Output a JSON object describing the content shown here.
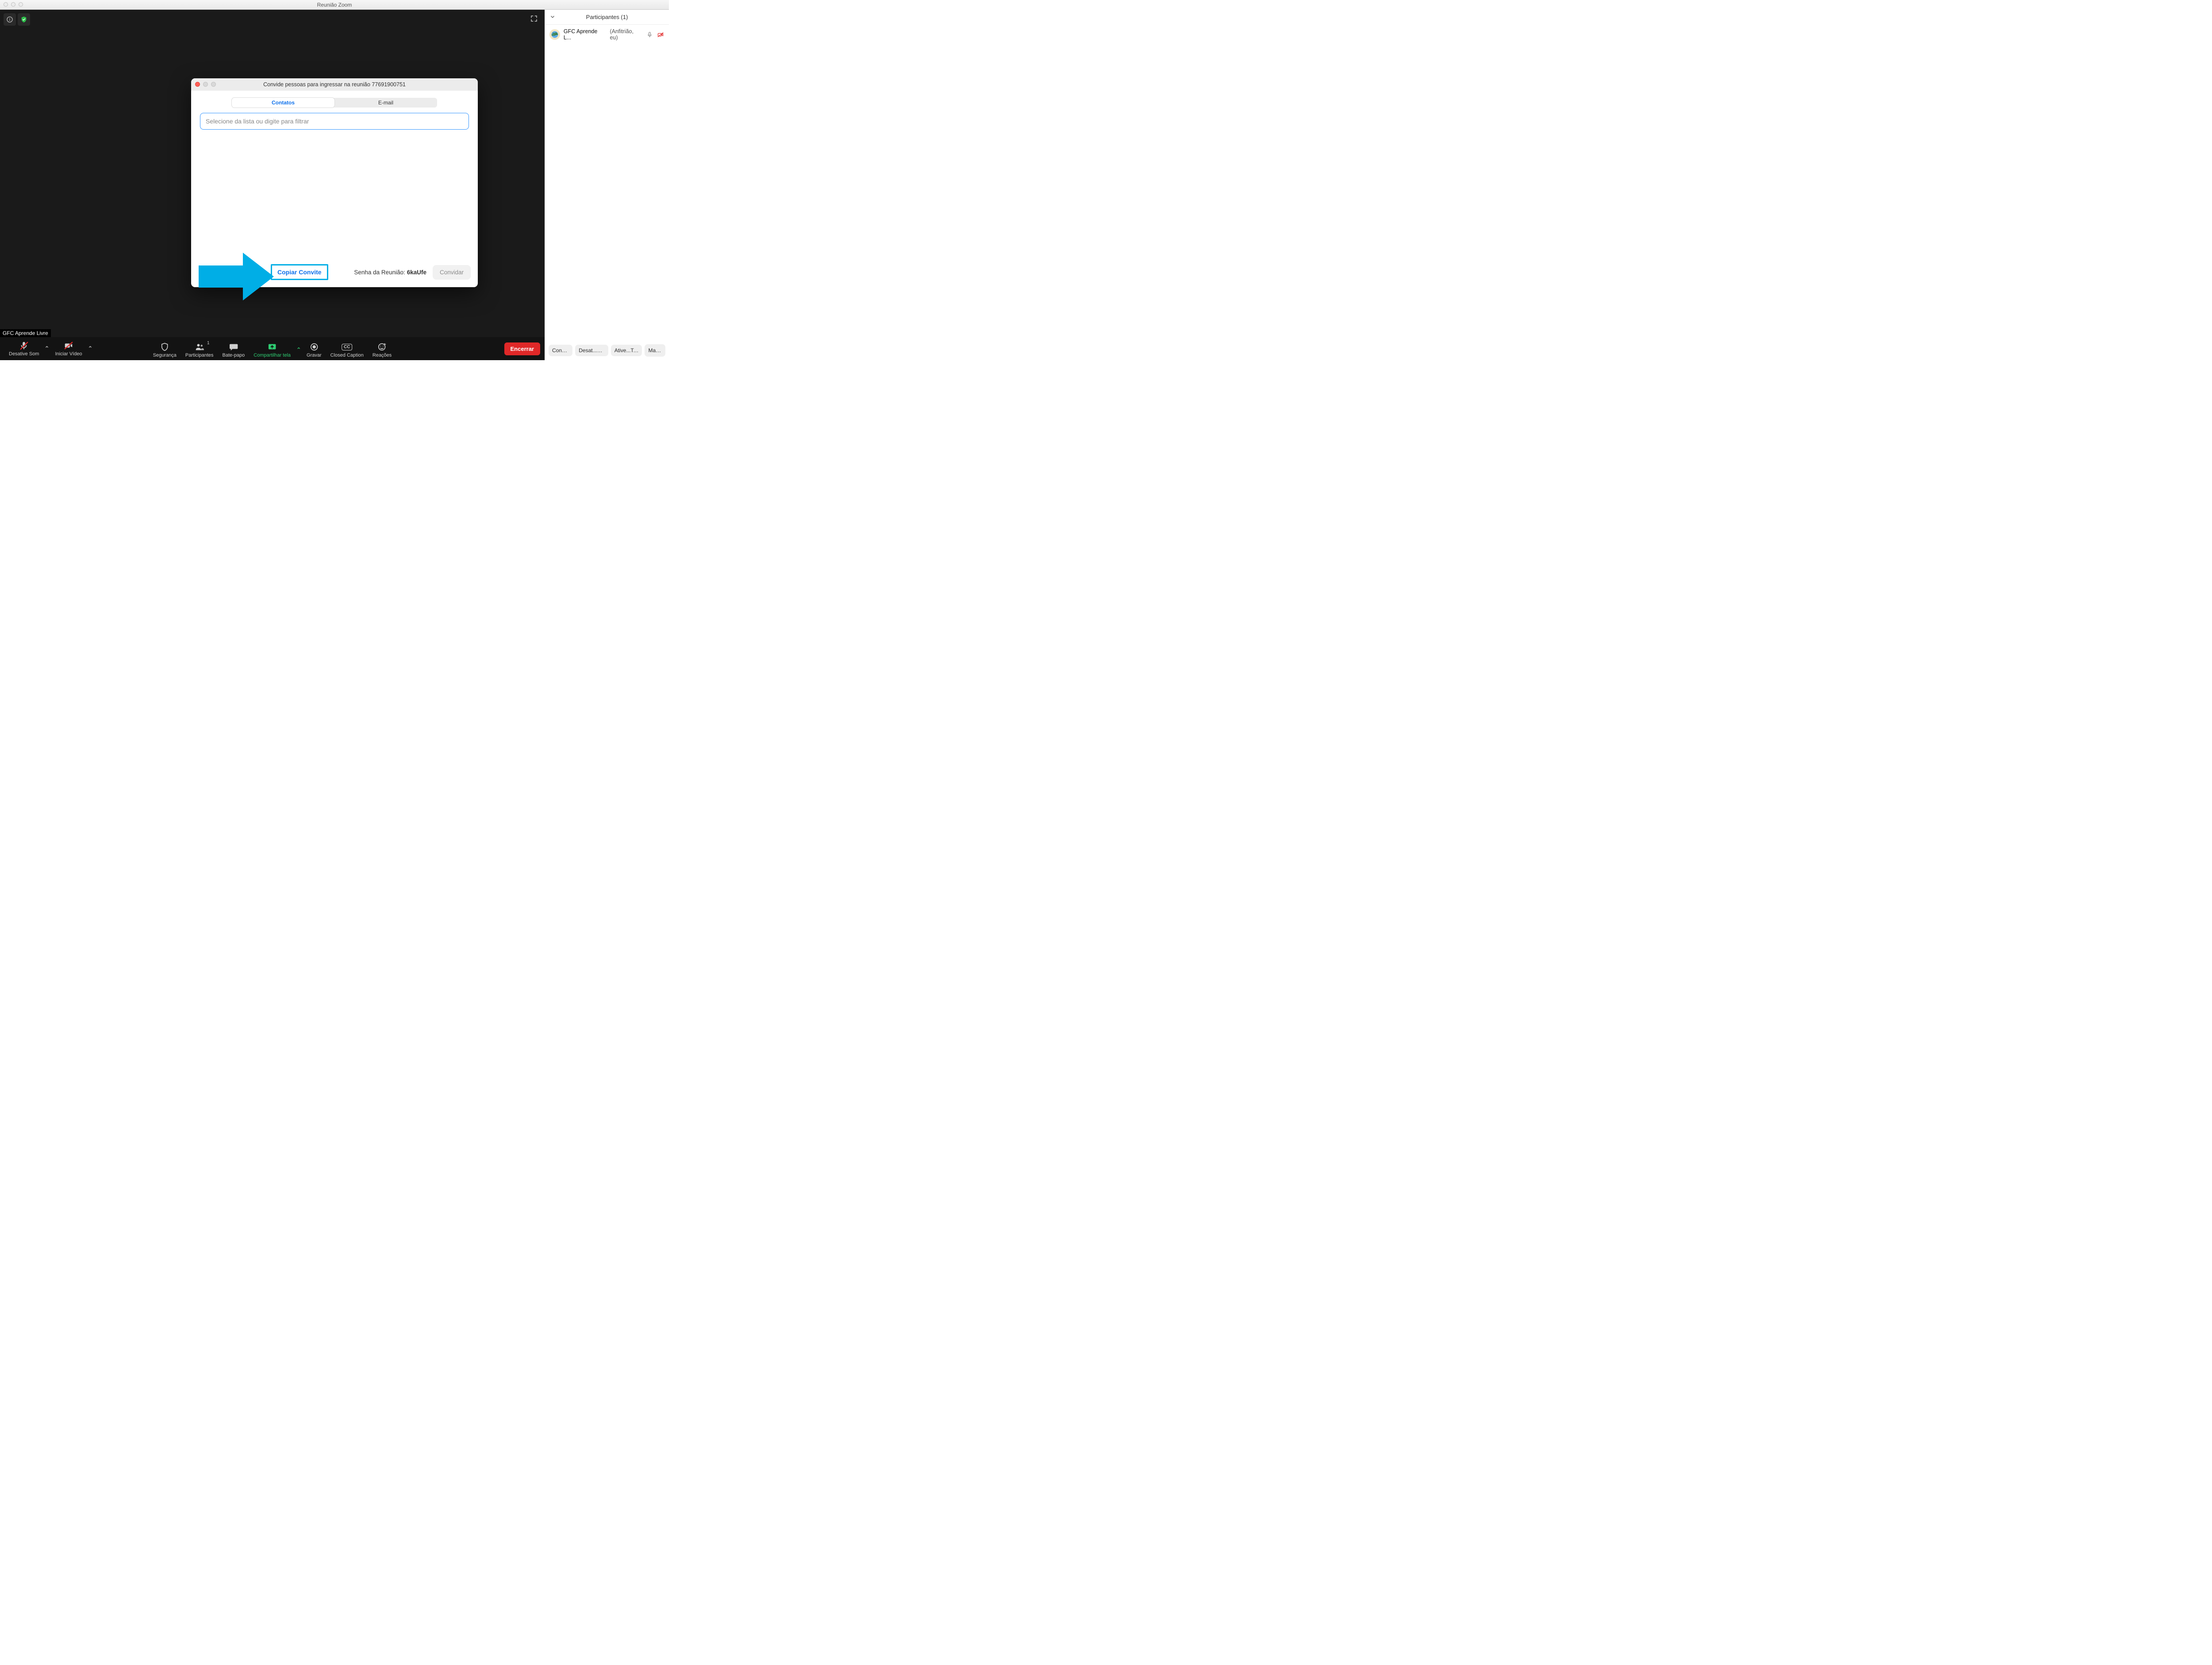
{
  "window_title": "Reunião Zoom",
  "top_icons": {
    "info": "info-icon",
    "shield": "shield-check-icon"
  },
  "user_overlay": "GFC Aprende Livre",
  "toolbar": {
    "mute": {
      "label": "Desative Som",
      "slashed": true
    },
    "video": {
      "label": "Iniciar Vídeo",
      "slashed": true
    },
    "security": {
      "label": "Segurança"
    },
    "participants": {
      "label": "Participantes",
      "count": "1"
    },
    "chat": {
      "label": "Bate-papo"
    },
    "share": {
      "label": "Compartilhar tela"
    },
    "record": {
      "label": "Gravar"
    },
    "cc": {
      "label": "Closed Caption",
      "badge": "CC"
    },
    "reactions": {
      "label": "Reações"
    },
    "end": {
      "label": "Encerrar"
    }
  },
  "participants_panel": {
    "title": "Participantes (1)",
    "rows": [
      {
        "name": "GFC Aprende L...",
        "sub": "(Anfitrião, eu)"
      }
    ],
    "footer": {
      "invite": "Convidar",
      "mute_all": "Desat...Todos",
      "ask_start": "Ative...Todos",
      "more": "Mais"
    }
  },
  "modal": {
    "title": "Convide pessoas para ingressar na reunião 77691900751",
    "tab_contacts": "Contatos",
    "tab_email": "E-mail",
    "search_placeholder": "Selecione da lista ou digite para filtrar",
    "copy_invite": "Copiar Convite",
    "password_label": "Senha da Reunião: ",
    "password_value": "6kaUfe",
    "invite": "Convidar"
  }
}
